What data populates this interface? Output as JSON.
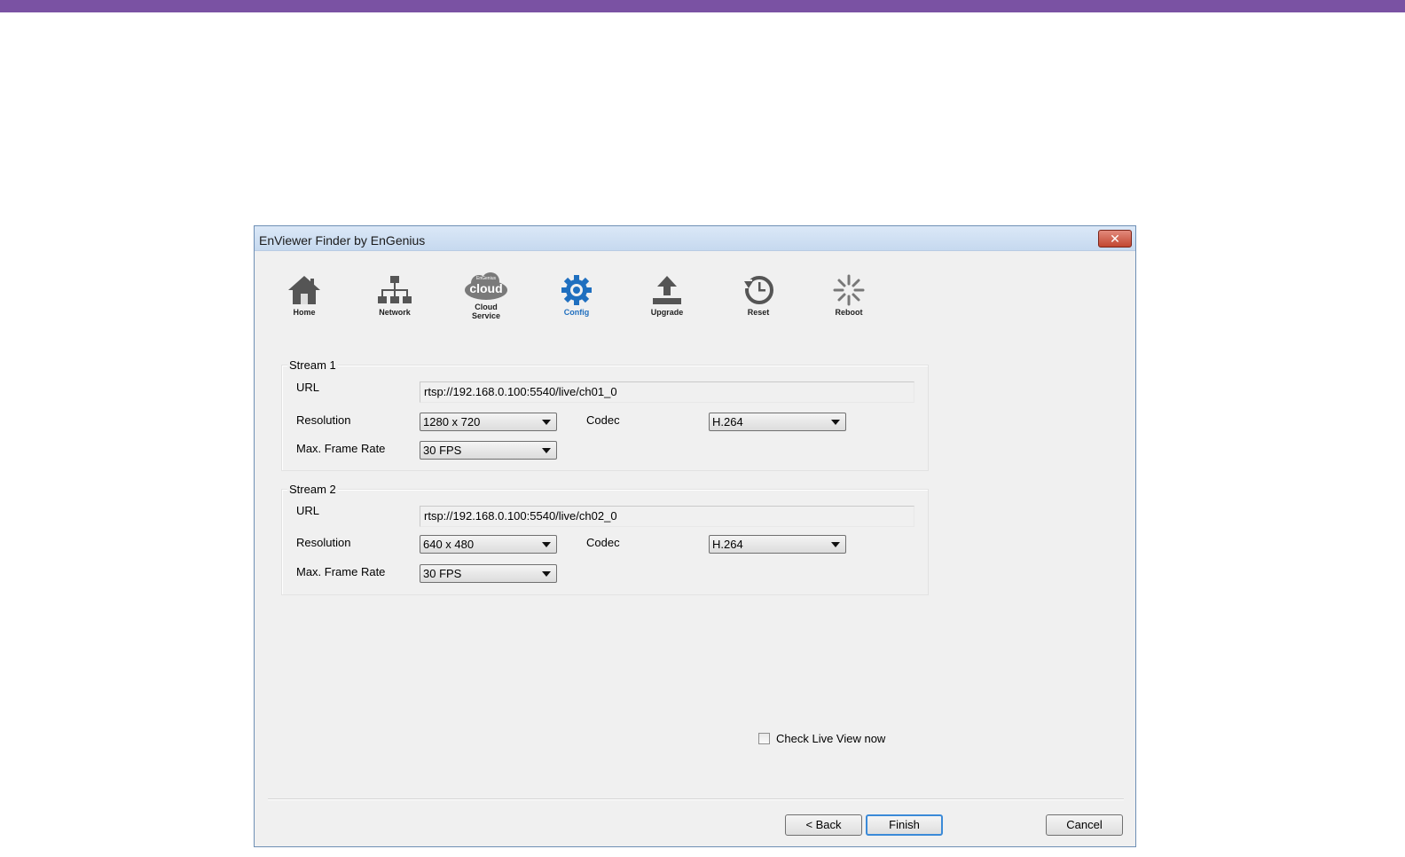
{
  "window": {
    "title": "EnViewer Finder by EnGenius",
    "close_label": "✕"
  },
  "toolbar": [
    {
      "id": "home",
      "label": "Home",
      "icon": "home-icon",
      "active": false
    },
    {
      "id": "network",
      "label": "Network",
      "icon": "network-icon",
      "active": false
    },
    {
      "id": "cloud",
      "label": "Cloud\nService",
      "icon": "cloud-icon",
      "icon_text": "cloud",
      "icon_subtext": "EnGenius",
      "active": false
    },
    {
      "id": "config",
      "label": "Config",
      "icon": "gear-icon",
      "active": true
    },
    {
      "id": "upgrade",
      "label": "Upgrade",
      "icon": "upload-icon",
      "active": false
    },
    {
      "id": "reset",
      "label": "Reset",
      "icon": "reset-clock-icon",
      "active": false
    },
    {
      "id": "reboot",
      "label": "Reboot",
      "icon": "reboot-spinner-icon",
      "active": false
    }
  ],
  "streams": [
    {
      "title": "Stream 1",
      "url_label": "URL",
      "url": "rtsp://192.168.0.100:5540/live/ch01_0",
      "resolution_label": "Resolution",
      "resolution": "1280 x 720",
      "codec_label": "Codec",
      "codec": "H.264",
      "framerate_label": "Max. Frame Rate",
      "framerate": "30 FPS"
    },
    {
      "title": "Stream 2",
      "url_label": "URL",
      "url": "rtsp://192.168.0.100:5540/live/ch02_0",
      "resolution_label": "Resolution",
      "resolution": "640 x 480",
      "codec_label": "Codec",
      "codec": "H.264",
      "framerate_label": "Max. Frame Rate",
      "framerate": "30 FPS"
    }
  ],
  "live_view": {
    "label": "Check Live View now",
    "checked": false
  },
  "buttons": {
    "back": "< Back",
    "finish": "Finish",
    "cancel": "Cancel"
  },
  "colors": {
    "accent": "#1f6fbf",
    "topbar": "#7a52a3",
    "close": "#c24631"
  }
}
